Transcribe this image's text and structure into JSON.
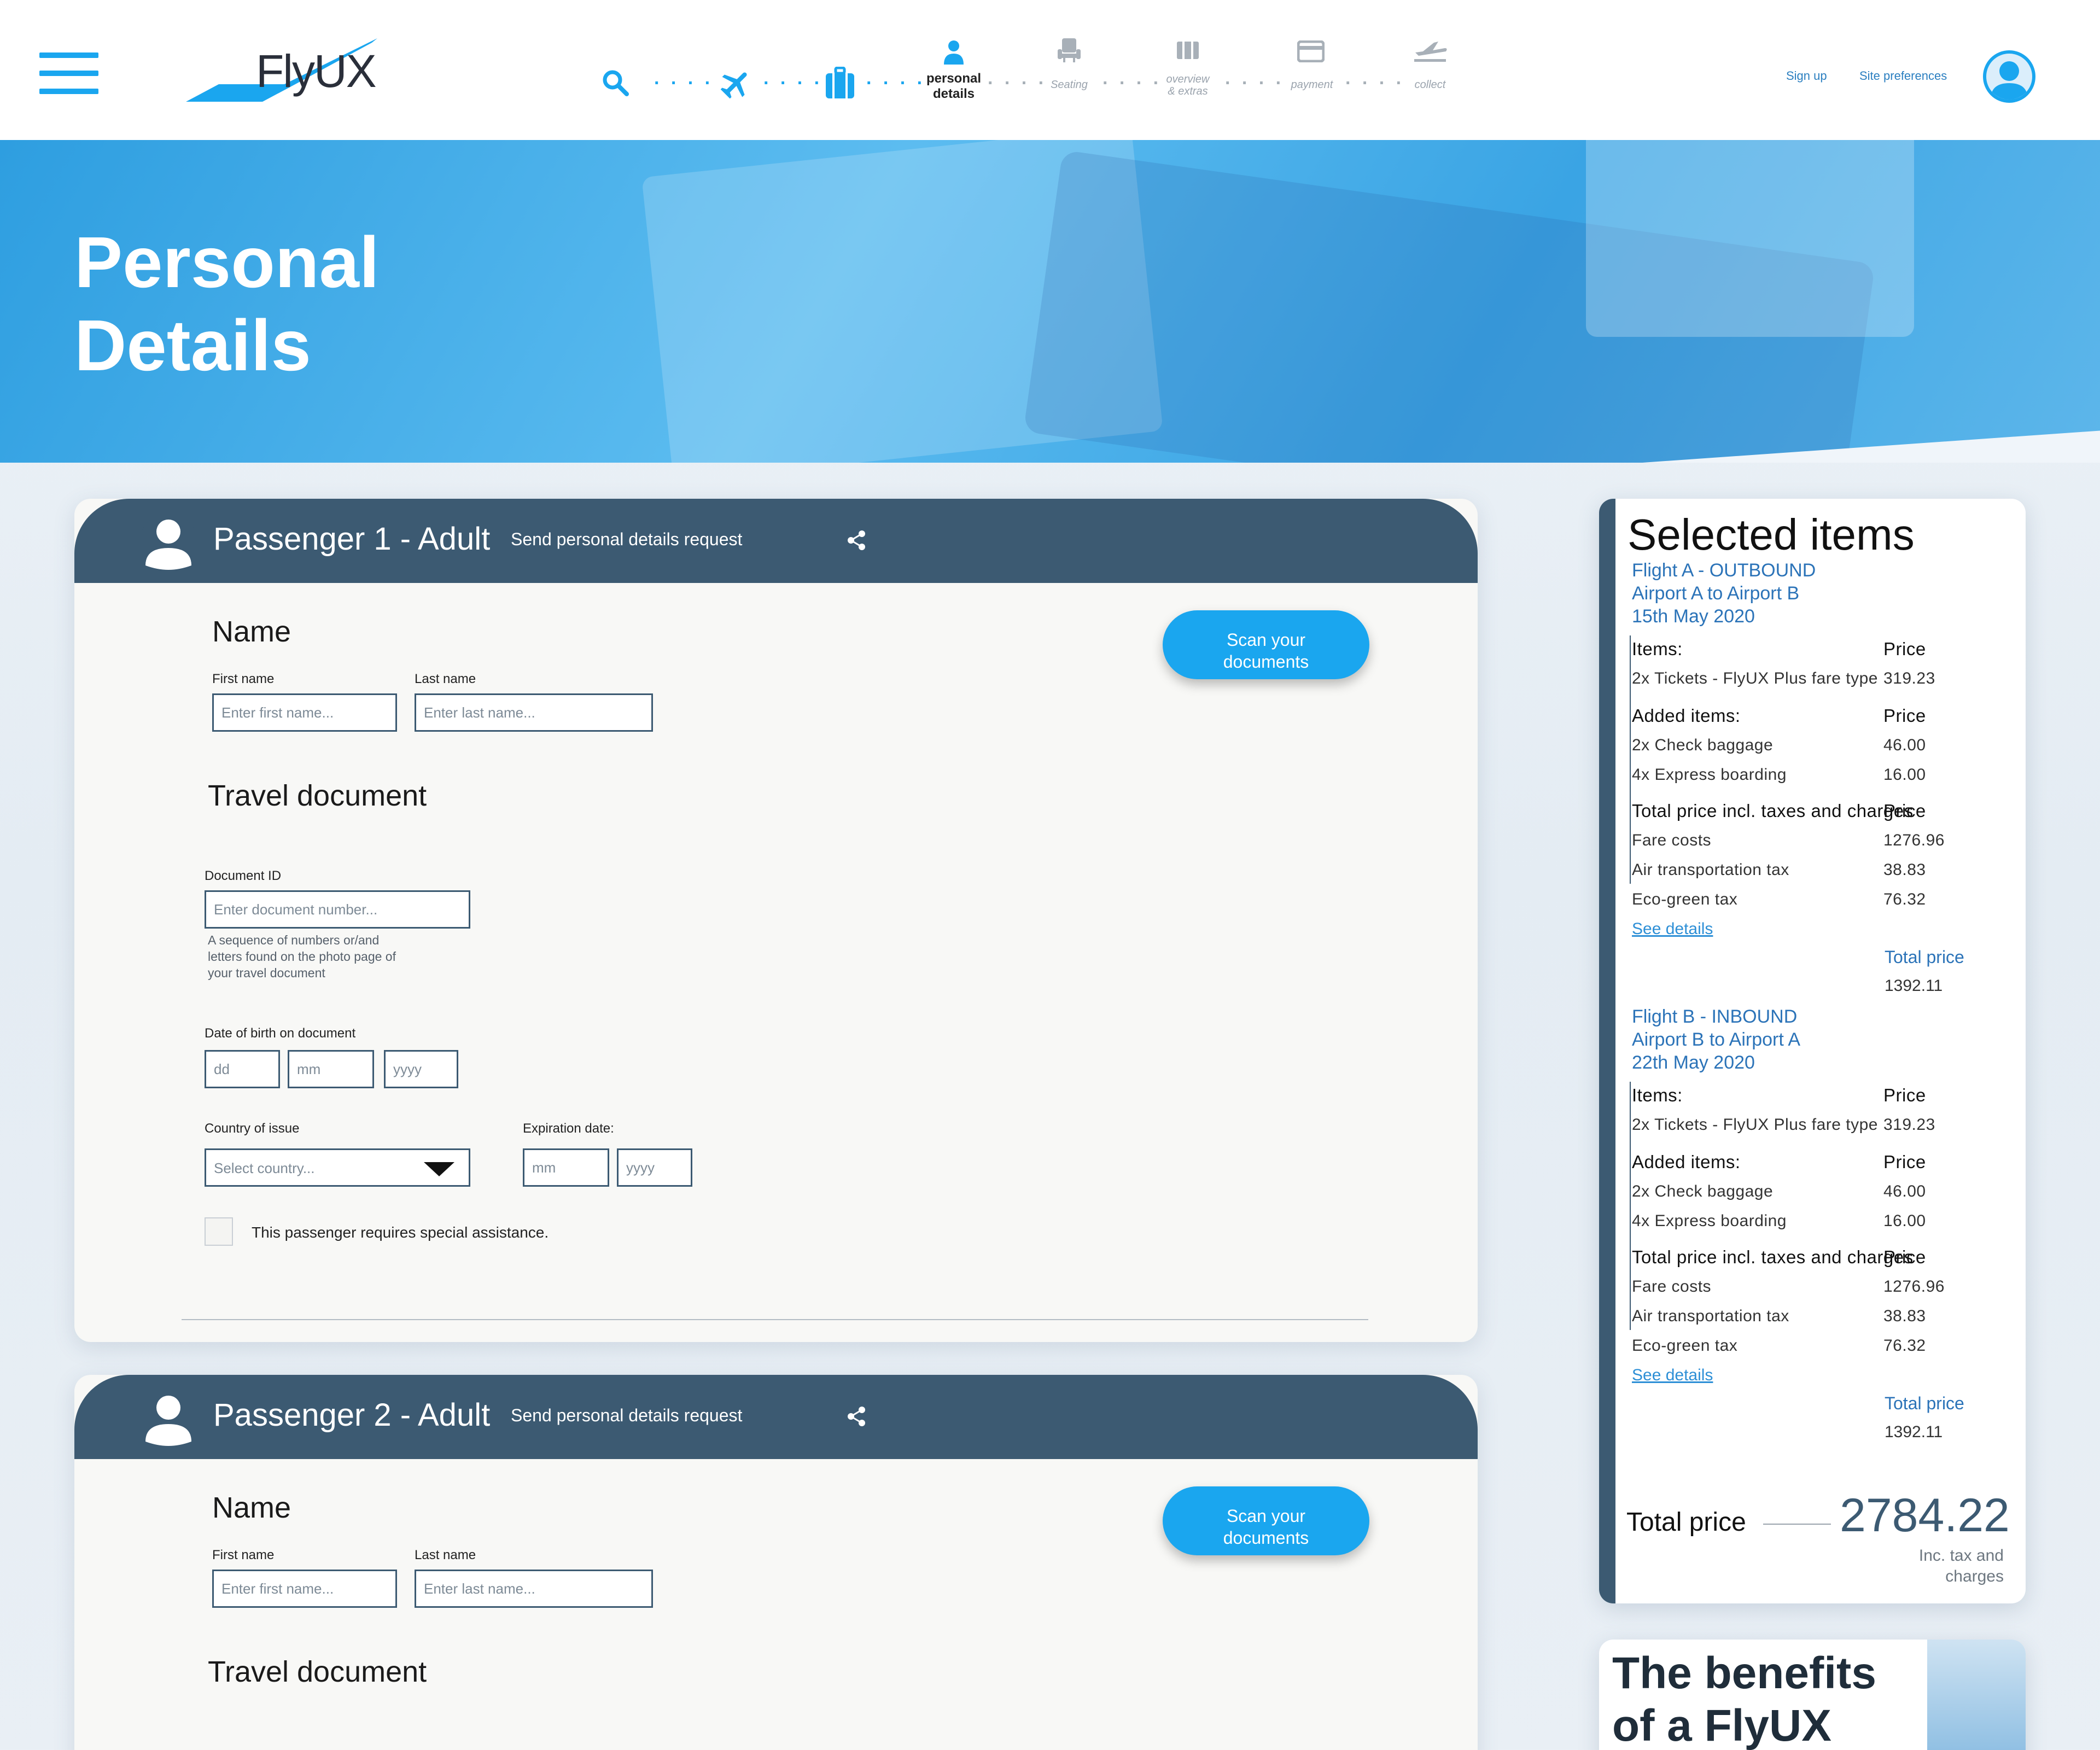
{
  "header": {
    "logo_text": "FlyUX",
    "steps": [
      {
        "label": "",
        "icon": "search-icon"
      },
      {
        "label": "",
        "icon": "plane-icon"
      },
      {
        "label": "",
        "icon": "luggage-icon"
      },
      {
        "label": "personal details",
        "icon": "person-icon"
      },
      {
        "label": "Seating",
        "icon": "seat-icon"
      },
      {
        "label": "overview & extras",
        "icon": "extras-icon"
      },
      {
        "label": "payment",
        "icon": "card-icon"
      },
      {
        "label": "collect",
        "icon": "departure-icon"
      }
    ],
    "step_personal_line1": "personal",
    "step_personal_line2": "details",
    "step_seating": "Seating",
    "step_overview_line1": "overview",
    "step_overview_line2": "& extras",
    "step_payment": "payment",
    "step_collect": "collect",
    "dots": ". . . .",
    "sign_up": "Sign up",
    "site_preferences": "Site preferences"
  },
  "hero": {
    "title_line1": "Personal",
    "title_line2": "Details"
  },
  "passengers": [
    {
      "title": "Passenger 1 - Adult",
      "send_request": "Send personal details request",
      "name_section": "Name",
      "first_name_label": "First name",
      "first_name_placeholder": "Enter first name...",
      "last_name_label": "Last name",
      "last_name_placeholder": "Enter last name...",
      "scan_line1": "Scan your",
      "scan_line2": "documents",
      "travel_section": "Travel document",
      "doc_id_label": "Document ID",
      "doc_id_placeholder": "Enter document number...",
      "doc_id_help_line1": "A sequence of numbers or/and",
      "doc_id_help_line2": "letters found on the photo page of",
      "doc_id_help_line3": "your travel document",
      "dob_label": "Date of birth on document",
      "dd": "dd",
      "mm": "mm",
      "yyyy": "yyyy",
      "country_label": "Country of issue",
      "country_placeholder": "Select country...",
      "expiry_label": "Expiration date:",
      "special_assistance": "This passenger requires special assistance."
    },
    {
      "title": "Passenger 2 - Adult",
      "send_request": "Send personal details request",
      "name_section": "Name",
      "first_name_label": "First name",
      "first_name_placeholder": "Enter first name...",
      "last_name_label": "Last name",
      "last_name_placeholder": "Enter last name...",
      "scan_line1": "Scan your",
      "scan_line2": "documents",
      "travel_section": "Travel document"
    }
  ],
  "sidebar": {
    "title": "Selected items",
    "flights": [
      {
        "line1": "Flight A - OUTBOUND",
        "line2": "Airport A to Airport B",
        "line3": "15th May 2020",
        "items_label": "Items:",
        "price_label": "Price",
        "ticket": "2x Tickets - FlyUX Plus fare type",
        "ticket_price": "319.23",
        "added_label": "Added items:",
        "baggage": "2x Check baggage",
        "baggage_price": "46.00",
        "boarding": "4x Express boarding",
        "boarding_price": "16.00",
        "total_incl_label": "Total price incl. taxes and charges",
        "fare_costs": "Fare costs",
        "fare_costs_price": "1276.96",
        "air_tax": "Air transportation tax",
        "air_tax_price": "38.83",
        "eco_tax": "Eco-green tax",
        "eco_tax_price": "76.32",
        "see_details": "See details",
        "total_price_label": "Total price",
        "total_price": "1392.11"
      },
      {
        "line1": "Flight B - INBOUND",
        "line2": "Airport B to Airport A",
        "line3": "22th May 2020",
        "items_label": "Items:",
        "price_label": "Price",
        "ticket": "2x Tickets - FlyUX Plus fare type",
        "ticket_price": "319.23",
        "added_label": "Added items:",
        "baggage": "2x Check baggage",
        "baggage_price": "46.00",
        "boarding": "4x Express boarding",
        "boarding_price": "16.00",
        "total_incl_label": "Total price incl. taxes and charges",
        "fare_costs": "Fare costs",
        "fare_costs_price": "1276.96",
        "air_tax": "Air transportation tax",
        "air_tax_price": "38.83",
        "eco_tax": "Eco-green tax",
        "eco_tax_price": "76.32",
        "see_details": "See details",
        "total_price_label": "Total price",
        "total_price": "1392.11"
      }
    ],
    "grand_total_label": "Total price",
    "grand_total": "2784.22",
    "grand_note_line1": "Inc. tax and",
    "grand_note_line2": "charges"
  },
  "benefits": {
    "title_line1": "The benefits",
    "title_line2": "of a FlyUX"
  },
  "colors": {
    "accent": "#1aa6ef",
    "header_bar": "#3c5a72",
    "link": "#2d8fd6",
    "flight_heading": "#2b73b8"
  }
}
